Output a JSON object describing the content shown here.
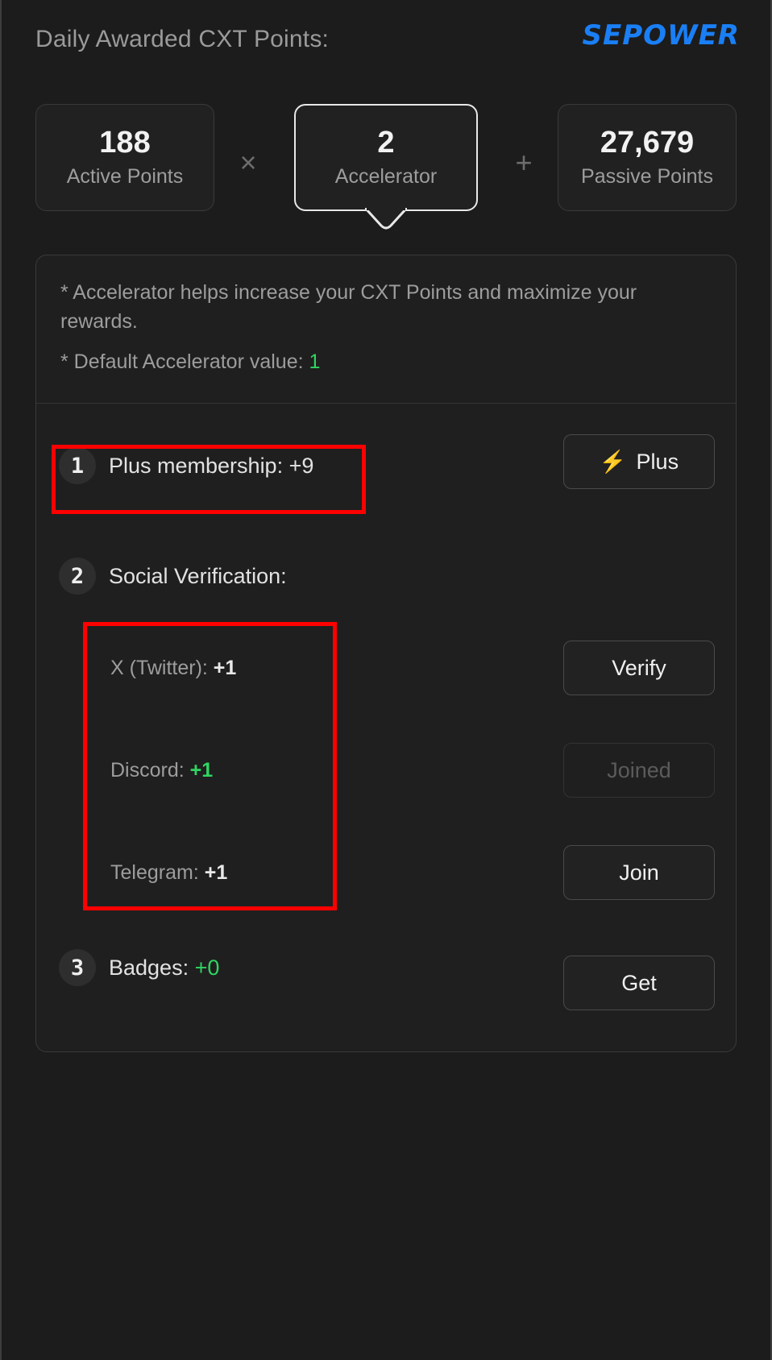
{
  "header": {
    "title": "Daily Awarded CXT Points:",
    "brand": "SEPOWER"
  },
  "stats": {
    "active": {
      "value": "188",
      "label": "Active Points"
    },
    "operator_times": "×",
    "accelerator": {
      "value": "2",
      "label": "Accelerator"
    },
    "operator_plus": "+",
    "passive": {
      "value": "27,679",
      "label": "Passive Points"
    }
  },
  "panel": {
    "note_1": "* Accelerator helps increase your CXT Points and maximize your rewards.",
    "note_2_prefix": "* Default Accelerator value:",
    "note_2_value": "1",
    "rows": [
      {
        "badge": "1",
        "label": "Plus membership: +9",
        "button": {
          "label": "Plus",
          "icon": "bolt-icon",
          "icon_glyph": "⚡",
          "disabled": false
        }
      },
      {
        "badge": "2",
        "label": "Social Verification:"
      },
      {
        "badge": "3",
        "label_prefix": "Badges:",
        "label_value": "+0",
        "button": {
          "label": "Get",
          "disabled": false
        }
      }
    ],
    "social": [
      {
        "name_prefix": "X (Twitter):",
        "value": "+1",
        "value_color": "white",
        "button": {
          "label": "Verify",
          "disabled": false
        }
      },
      {
        "name_prefix": "Discord:",
        "value": "+1",
        "value_color": "green",
        "button": {
          "label": "Joined",
          "disabled": true
        }
      },
      {
        "name_prefix": "Telegram:",
        "value": "+1",
        "value_color": "white",
        "button": {
          "label": "Join",
          "disabled": false
        }
      }
    ]
  },
  "colors": {
    "accent_green": "#2fd561",
    "brand_blue": "#1a7ff5",
    "bolt_yellow": "#f5d90a",
    "annotation_red": "#ff0000",
    "background": "#1c1c1c"
  }
}
